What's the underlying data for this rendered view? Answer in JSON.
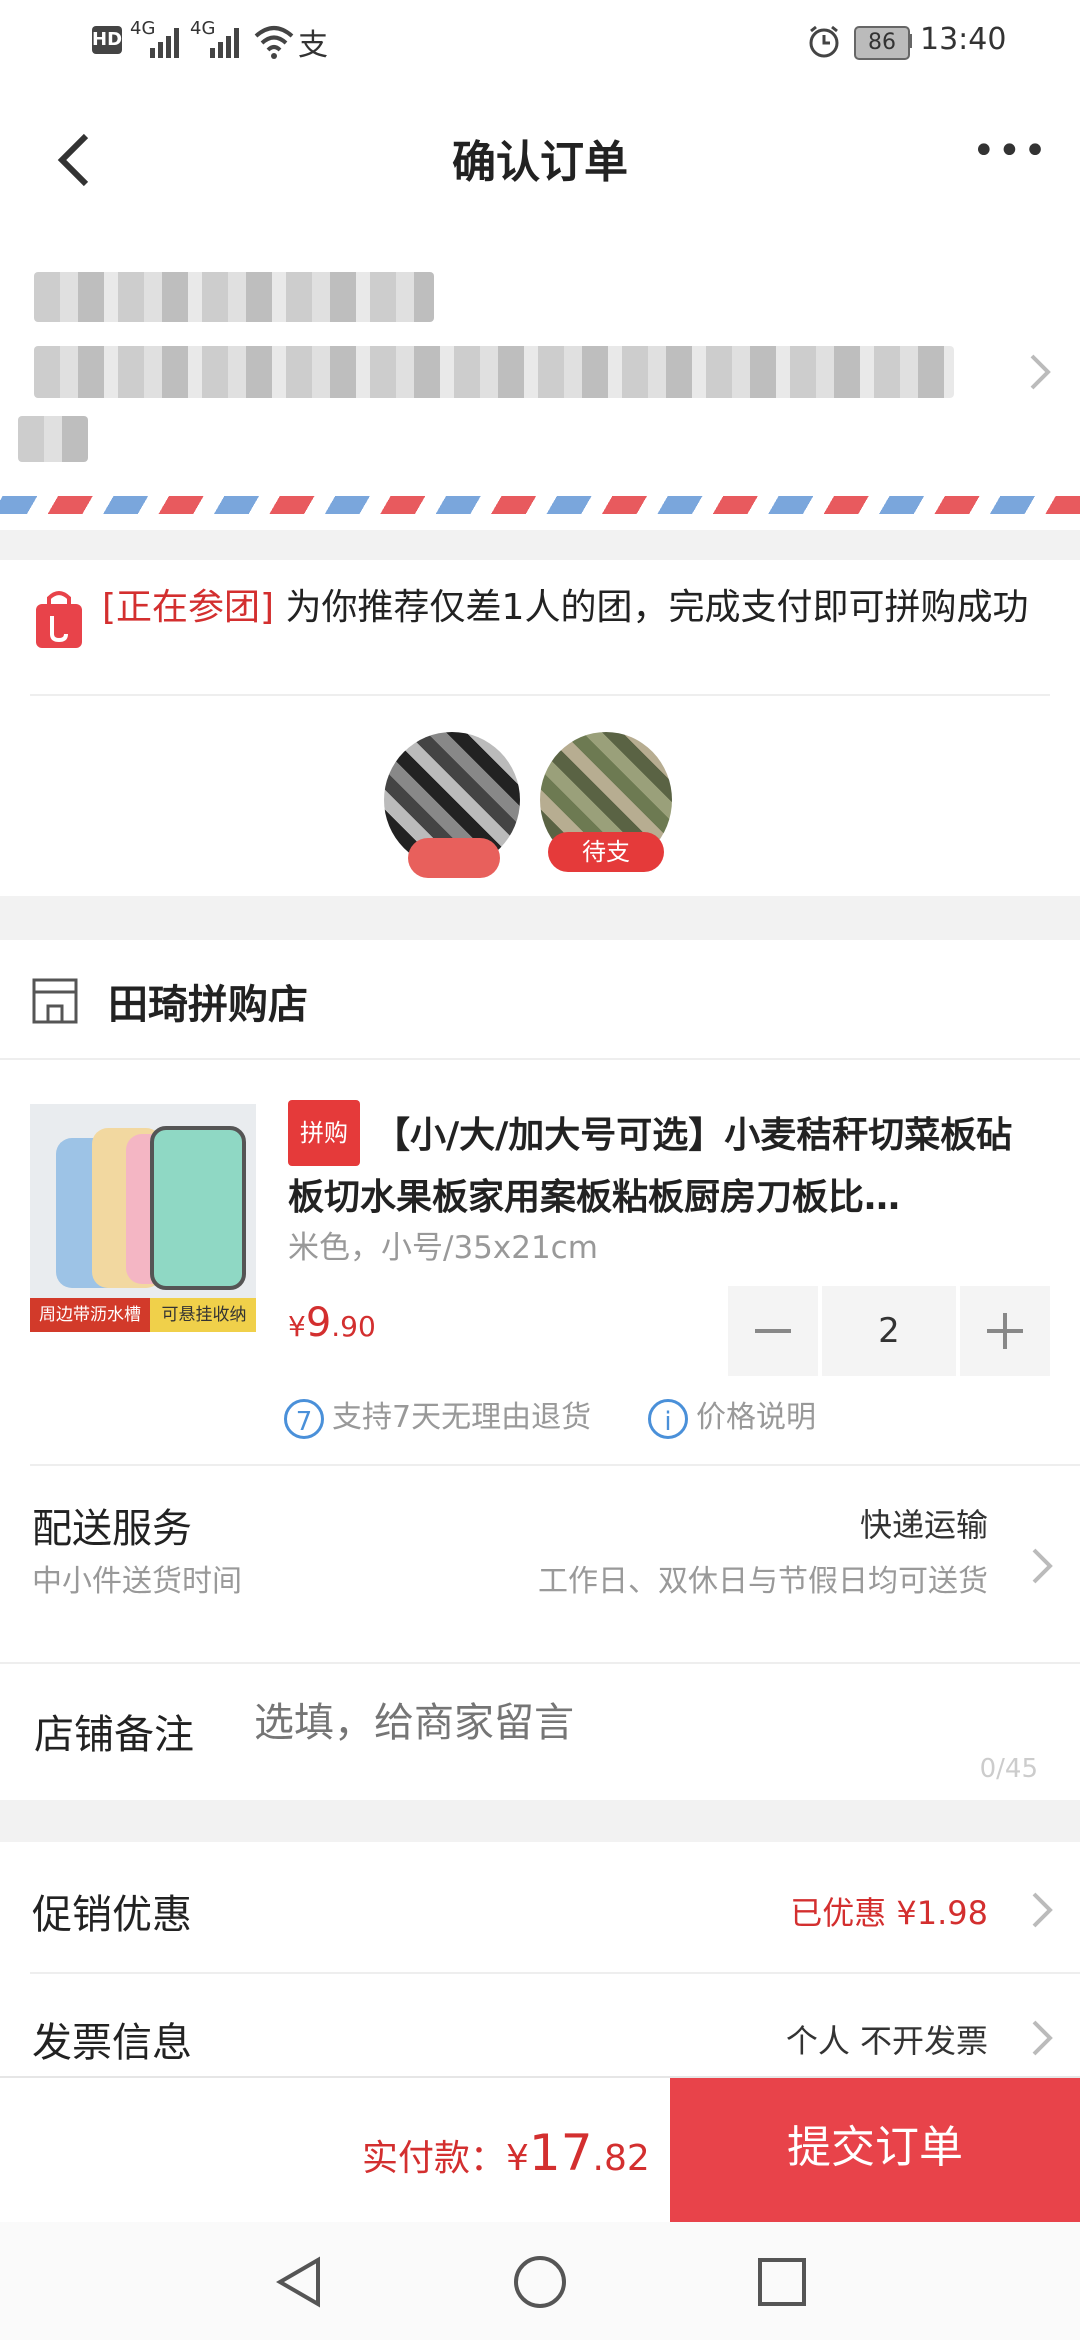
{
  "status_bar": {
    "hd": "HD",
    "net1": "4G",
    "net2": "4G",
    "alipay_glyph": "支",
    "battery": "86",
    "time": "13:40"
  },
  "nav": {
    "title": "确认订单",
    "more": "•••"
  },
  "group": {
    "tag": "[正在参团]",
    "message": "为你推荐仅差1人的团，完成支付即可拼购成功",
    "member2_status": "待支"
  },
  "shop": {
    "name": "田琦拼购店",
    "product": {
      "badge": "拼购",
      "title": "【小/大/加大号可选】小麦秸秆切菜板砧板切水果板家用案板粘板厨房刀板比…",
      "spec": "米色，小号/35x21cm",
      "price_symbol": "¥",
      "price_int": "9",
      "price_dec": ".90",
      "quantity": "2",
      "image_caption_left": "周边带沥水槽",
      "image_caption_right": "可悬挂收纳",
      "guarantee_num": "7",
      "guarantee_text": "支持7天无理由退货",
      "price_note_icon": "i",
      "price_note": "价格说明"
    },
    "delivery": {
      "label": "配送服务",
      "value": "快递运输",
      "sub_label": "中小件送货时间",
      "sub_value": "工作日、双休日与节假日均可送货"
    },
    "remark": {
      "label": "店铺备注",
      "placeholder": "选填，给商家留言",
      "counter": "0/45"
    }
  },
  "promo": {
    "label": "促销优惠",
    "value": "已优惠 ¥1.98"
  },
  "invoice": {
    "label": "发票信息",
    "value": "个人 不开发票"
  },
  "bottom": {
    "pay_label": "实付款：¥",
    "pay_int": "17",
    "pay_dec": ".82",
    "submit": "提交订单"
  },
  "colors": {
    "accent": "#e8434a",
    "price_red": "#d32f2f",
    "info_blue": "#4a90d9"
  }
}
